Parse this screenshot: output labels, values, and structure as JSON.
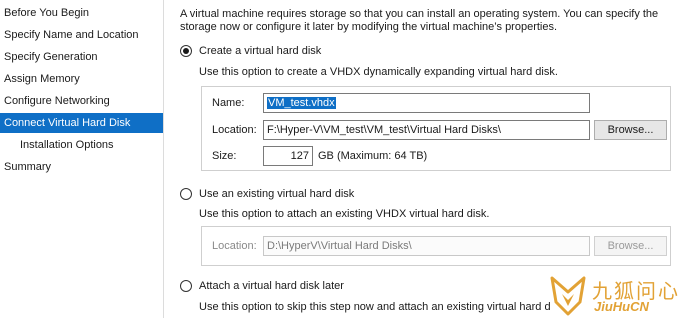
{
  "nav": {
    "items": [
      {
        "label": "Before You Begin"
      },
      {
        "label": "Specify Name and Location"
      },
      {
        "label": "Specify Generation"
      },
      {
        "label": "Assign Memory"
      },
      {
        "label": "Configure Networking"
      },
      {
        "label": "Connect Virtual Hard Disk"
      },
      {
        "label": "Installation Options"
      },
      {
        "label": "Summary"
      }
    ],
    "active_index": 5
  },
  "intro": "A virtual machine requires storage so that you can install an operating system. You can specify the storage now or configure it later by modifying the virtual machine’s properties.",
  "options": {
    "create": {
      "label": "Create a virtual hard disk",
      "description": "Use this option to create a VHDX dynamically expanding virtual hard disk.",
      "selected": true,
      "name_label": "Name:",
      "name_value": "VM_test.vhdx",
      "location_label": "Location:",
      "location_value": "F:\\Hyper-V\\VM_test\\VM_test\\Virtual Hard Disks\\",
      "browse_label": "Browse...",
      "size_label": "Size:",
      "size_value": "127",
      "size_unit": "GB (Maximum: 64 TB)"
    },
    "existing": {
      "label": "Use an existing virtual hard disk",
      "description": "Use this option to attach an existing VHDX virtual hard disk.",
      "selected": false,
      "location_label": "Location:",
      "location_value": "D:\\HyperV\\Virtual Hard Disks\\",
      "browse_label": "Browse..."
    },
    "later": {
      "label": "Attach a virtual hard disk later",
      "description": "Use this option to skip this step now and attach an existing virtual hard d",
      "selected": false
    }
  },
  "watermark": {
    "cn": "九狐问心",
    "en": "JiuHuCN"
  },
  "colors": {
    "accent": "#0f6fc6",
    "watermark": "#e2a235"
  }
}
